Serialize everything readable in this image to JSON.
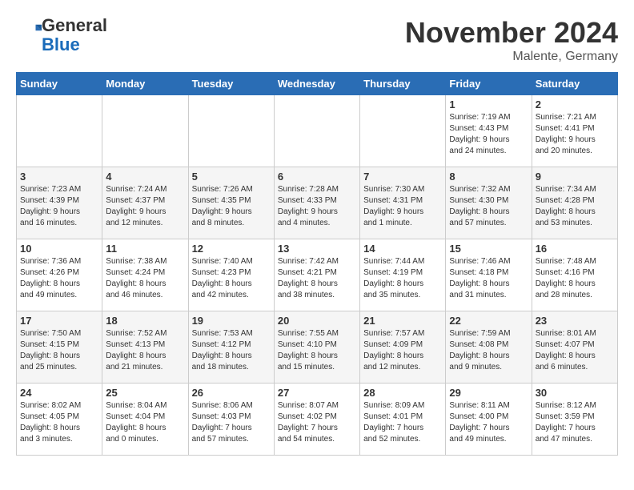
{
  "header": {
    "logo_general": "General",
    "logo_blue": "Blue",
    "month_title": "November 2024",
    "location": "Malente, Germany"
  },
  "weekdays": [
    "Sunday",
    "Monday",
    "Tuesday",
    "Wednesday",
    "Thursday",
    "Friday",
    "Saturday"
  ],
  "weeks": [
    [
      {
        "day": "",
        "info": ""
      },
      {
        "day": "",
        "info": ""
      },
      {
        "day": "",
        "info": ""
      },
      {
        "day": "",
        "info": ""
      },
      {
        "day": "",
        "info": ""
      },
      {
        "day": "1",
        "info": "Sunrise: 7:19 AM\nSunset: 4:43 PM\nDaylight: 9 hours\nand 24 minutes."
      },
      {
        "day": "2",
        "info": "Sunrise: 7:21 AM\nSunset: 4:41 PM\nDaylight: 9 hours\nand 20 minutes."
      }
    ],
    [
      {
        "day": "3",
        "info": "Sunrise: 7:23 AM\nSunset: 4:39 PM\nDaylight: 9 hours\nand 16 minutes."
      },
      {
        "day": "4",
        "info": "Sunrise: 7:24 AM\nSunset: 4:37 PM\nDaylight: 9 hours\nand 12 minutes."
      },
      {
        "day": "5",
        "info": "Sunrise: 7:26 AM\nSunset: 4:35 PM\nDaylight: 9 hours\nand 8 minutes."
      },
      {
        "day": "6",
        "info": "Sunrise: 7:28 AM\nSunset: 4:33 PM\nDaylight: 9 hours\nand 4 minutes."
      },
      {
        "day": "7",
        "info": "Sunrise: 7:30 AM\nSunset: 4:31 PM\nDaylight: 9 hours\nand 1 minute."
      },
      {
        "day": "8",
        "info": "Sunrise: 7:32 AM\nSunset: 4:30 PM\nDaylight: 8 hours\nand 57 minutes."
      },
      {
        "day": "9",
        "info": "Sunrise: 7:34 AM\nSunset: 4:28 PM\nDaylight: 8 hours\nand 53 minutes."
      }
    ],
    [
      {
        "day": "10",
        "info": "Sunrise: 7:36 AM\nSunset: 4:26 PM\nDaylight: 8 hours\nand 49 minutes."
      },
      {
        "day": "11",
        "info": "Sunrise: 7:38 AM\nSunset: 4:24 PM\nDaylight: 8 hours\nand 46 minutes."
      },
      {
        "day": "12",
        "info": "Sunrise: 7:40 AM\nSunset: 4:23 PM\nDaylight: 8 hours\nand 42 minutes."
      },
      {
        "day": "13",
        "info": "Sunrise: 7:42 AM\nSunset: 4:21 PM\nDaylight: 8 hours\nand 38 minutes."
      },
      {
        "day": "14",
        "info": "Sunrise: 7:44 AM\nSunset: 4:19 PM\nDaylight: 8 hours\nand 35 minutes."
      },
      {
        "day": "15",
        "info": "Sunrise: 7:46 AM\nSunset: 4:18 PM\nDaylight: 8 hours\nand 31 minutes."
      },
      {
        "day": "16",
        "info": "Sunrise: 7:48 AM\nSunset: 4:16 PM\nDaylight: 8 hours\nand 28 minutes."
      }
    ],
    [
      {
        "day": "17",
        "info": "Sunrise: 7:50 AM\nSunset: 4:15 PM\nDaylight: 8 hours\nand 25 minutes."
      },
      {
        "day": "18",
        "info": "Sunrise: 7:52 AM\nSunset: 4:13 PM\nDaylight: 8 hours\nand 21 minutes."
      },
      {
        "day": "19",
        "info": "Sunrise: 7:53 AM\nSunset: 4:12 PM\nDaylight: 8 hours\nand 18 minutes."
      },
      {
        "day": "20",
        "info": "Sunrise: 7:55 AM\nSunset: 4:10 PM\nDaylight: 8 hours\nand 15 minutes."
      },
      {
        "day": "21",
        "info": "Sunrise: 7:57 AM\nSunset: 4:09 PM\nDaylight: 8 hours\nand 12 minutes."
      },
      {
        "day": "22",
        "info": "Sunrise: 7:59 AM\nSunset: 4:08 PM\nDaylight: 8 hours\nand 9 minutes."
      },
      {
        "day": "23",
        "info": "Sunrise: 8:01 AM\nSunset: 4:07 PM\nDaylight: 8 hours\nand 6 minutes."
      }
    ],
    [
      {
        "day": "24",
        "info": "Sunrise: 8:02 AM\nSunset: 4:05 PM\nDaylight: 8 hours\nand 3 minutes."
      },
      {
        "day": "25",
        "info": "Sunrise: 8:04 AM\nSunset: 4:04 PM\nDaylight: 8 hours\nand 0 minutes."
      },
      {
        "day": "26",
        "info": "Sunrise: 8:06 AM\nSunset: 4:03 PM\nDaylight: 7 hours\nand 57 minutes."
      },
      {
        "day": "27",
        "info": "Sunrise: 8:07 AM\nSunset: 4:02 PM\nDaylight: 7 hours\nand 54 minutes."
      },
      {
        "day": "28",
        "info": "Sunrise: 8:09 AM\nSunset: 4:01 PM\nDaylight: 7 hours\nand 52 minutes."
      },
      {
        "day": "29",
        "info": "Sunrise: 8:11 AM\nSunset: 4:00 PM\nDaylight: 7 hours\nand 49 minutes."
      },
      {
        "day": "30",
        "info": "Sunrise: 8:12 AM\nSunset: 3:59 PM\nDaylight: 7 hours\nand 47 minutes."
      }
    ]
  ]
}
